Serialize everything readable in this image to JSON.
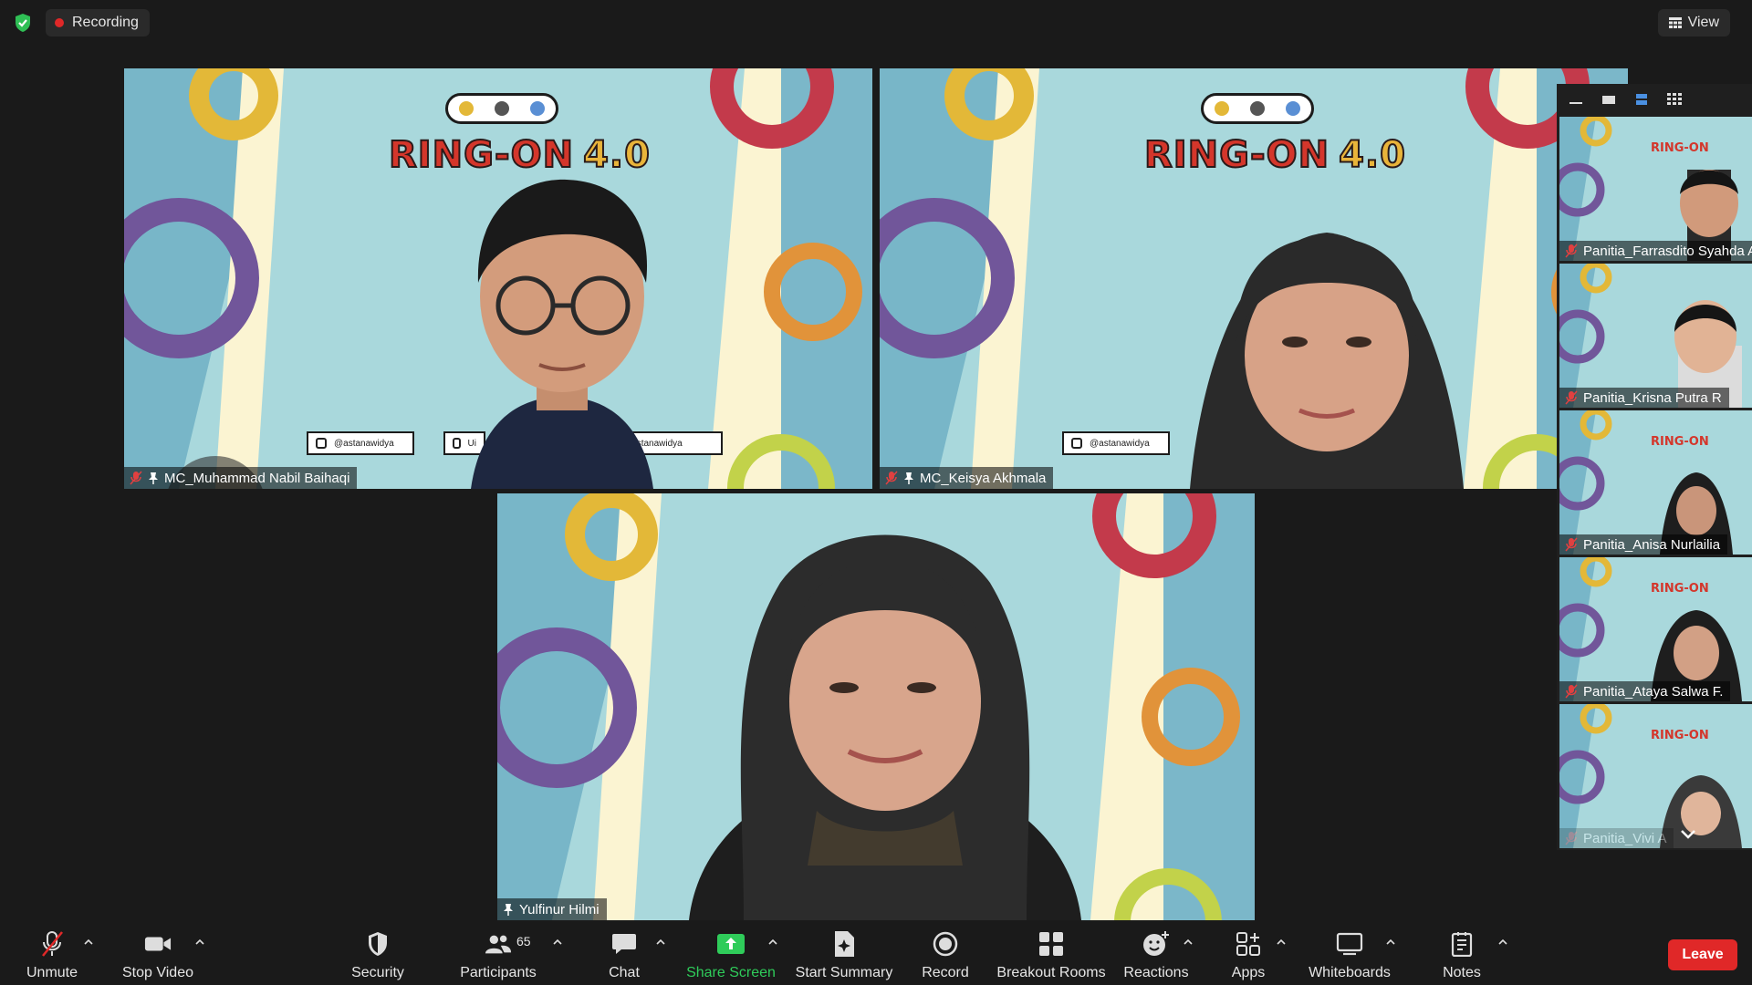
{
  "top_bar": {
    "recording_label": "Recording",
    "view_label": "View"
  },
  "video_tiles": [
    {
      "name": "MC_Muhammad Nabil Baihaqi",
      "muted": true,
      "pinned": true,
      "social": [
        "@astanawidya",
        "Ui",
        "@astanawidya"
      ]
    },
    {
      "name": "MC_Keisya Akhmala",
      "muted": true,
      "pinned": true,
      "social": [
        "@astanawidya"
      ]
    },
    {
      "name": "Yulfinur Hilmi",
      "muted": false,
      "pinned": true,
      "active_speaker": true
    }
  ],
  "event_brand": {
    "title": "RING-ON",
    "version": "4.0"
  },
  "sidebar": {
    "participants": [
      {
        "name": "Panitia_Farrasdito Syahda A",
        "muted": true
      },
      {
        "name": "Panitia_Krisna Putra R",
        "muted": true
      },
      {
        "name": "Panitia_Anisa Nurlailia",
        "muted": true
      },
      {
        "name": "Panitia_Ataya Salwa F.",
        "muted": true
      },
      {
        "name": "Panitia_Vivi A",
        "muted": true
      }
    ]
  },
  "toolbar": {
    "unmute": "Unmute",
    "stop_video": "Stop Video",
    "security": "Security",
    "participants": "Participants",
    "participant_count": "65",
    "chat": "Chat",
    "share_screen": "Share Screen",
    "start_summary": "Start Summary",
    "record": "Record",
    "breakout_rooms": "Breakout Rooms",
    "reactions": "Reactions",
    "apps": "Apps",
    "whiteboards": "Whiteboards",
    "notes": "Notes",
    "leave": "Leave"
  },
  "colors": {
    "accent_green": "#2fcc5a",
    "leave_red": "#e02828",
    "active_speaker_outline": "#c4e84a",
    "background_teal": "#9fd0d6"
  }
}
